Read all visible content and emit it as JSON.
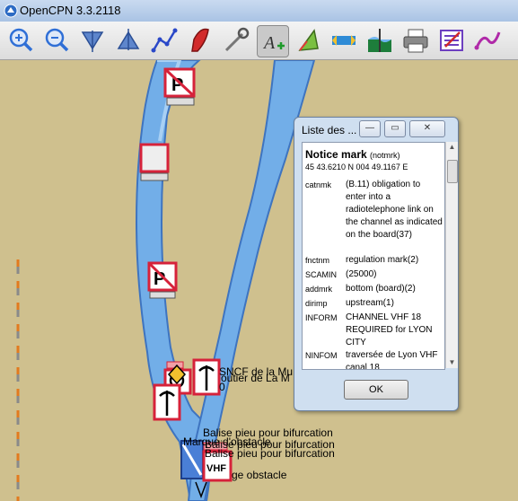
{
  "window": {
    "title": "OpenCPN 3.3.2118"
  },
  "toolbar": {
    "buttons": [
      {
        "name": "zoom-in-icon",
        "color": "#2f6fd6"
      },
      {
        "name": "zoom-out-icon",
        "color": "#2f6fd6"
      },
      {
        "name": "scale-in-icon",
        "color": "#3b66b8"
      },
      {
        "name": "scale-out-icon",
        "color": "#3b66b8"
      },
      {
        "name": "route-icon",
        "color": "#2a48c8"
      },
      {
        "name": "ship-icon",
        "color": "#d22a2a"
      },
      {
        "name": "measure-icon",
        "color": "#666666"
      },
      {
        "name": "text-icon",
        "color": "#444444"
      },
      {
        "name": "tide-icon",
        "color": "#7ac041"
      },
      {
        "name": "current-icon",
        "color": "#2e8bd6"
      },
      {
        "name": "chart-icon",
        "color": "#1d7d3b"
      },
      {
        "name": "print-icon",
        "color": "#555555"
      },
      {
        "name": "settings-icon",
        "color": "#6d3fc0"
      },
      {
        "name": "track-icon",
        "color": "#b02aa8"
      }
    ]
  },
  "map": {
    "labels": [
      {
        "text": "SNCF de la Mu"
      },
      {
        "text": "outier de La M"
      },
      {
        "text": "0"
      },
      {
        "text": "Balise pieu pour bifurcation"
      },
      {
        "text": "Marque d'obstacle"
      },
      {
        "text": "Balise pieu pour bifurcation"
      },
      {
        "text": "Balise pieu pour bifurcation"
      },
      {
        "text": "ge obstacle"
      }
    ],
    "colors": {
      "land": "#cfc08e",
      "water": "#72aee8",
      "water_edge": "#3e74c0"
    }
  },
  "dialog": {
    "title": "Liste des ...",
    "heading": "Notice mark",
    "heading_code": "(notmrk)",
    "position": "45 43.6210 N 004 49.1167 E",
    "attributes": [
      {
        "key": "catnmk",
        "value": "(B.11) obligation to enter into a radiotelephone link on the channel as indicated on the board(37)"
      },
      {
        "key": "fnctnm",
        "value": "regulation mark(2)"
      },
      {
        "key": "SCAMIN",
        "value": "(25000)"
      },
      {
        "key": "addmrk",
        "value": "bottom (board)(2)"
      },
      {
        "key": "dirimp",
        "value": "upstream(1)"
      },
      {
        "key": "INFORM",
        "value": "CHANNEL VHF 18 REQUIRED for LYON CITY"
      },
      {
        "key": "NINFOM",
        "value": "traversée de Lyon VHF canal 18"
      }
    ],
    "ok_label": "OK",
    "minimize_glyph": "—",
    "maximize_glyph": "▭",
    "close_glyph": "✕"
  }
}
